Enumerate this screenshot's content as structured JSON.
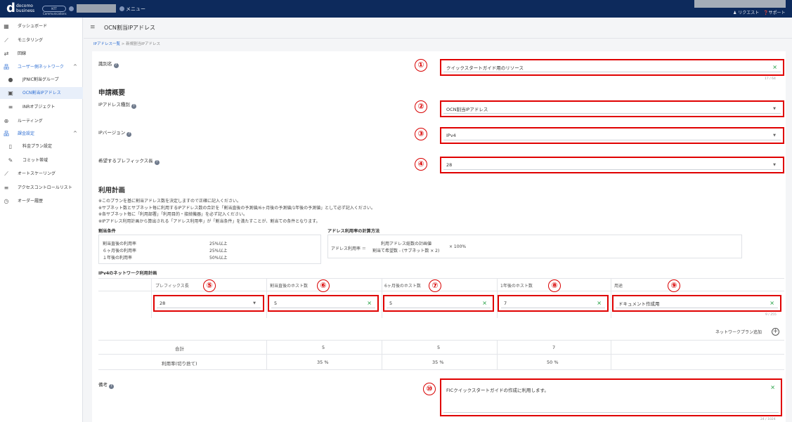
{
  "header": {
    "brand_d": "d",
    "brand_text_1": "docomo",
    "brand_text_2": "business",
    "partner_logo": "NTT Communications",
    "menu_label": "メニュー",
    "request_label": "リクエスト",
    "support_label": "サポート"
  },
  "sidebar": {
    "items": [
      {
        "label": "ダッシュボード",
        "icon": "dashboard-icon"
      },
      {
        "label": "モニタリング",
        "icon": "chart-icon"
      },
      {
        "label": "回線",
        "icon": "line-icon"
      },
      {
        "label": "ユーザー側ネットワーク",
        "icon": "network-icon"
      },
      {
        "label": "JPNIC割当グループ",
        "icon": "user-icon"
      },
      {
        "label": "OCN割当IPアドレス",
        "icon": "ip-icon"
      },
      {
        "label": "INRオブジェクト",
        "icon": "db-icon"
      },
      {
        "label": "ルーティング",
        "icon": "routing-icon"
      },
      {
        "label": "課金設定",
        "icon": "billing-icon"
      },
      {
        "label": "料金プラン設定",
        "icon": "doc-icon"
      },
      {
        "label": "コミット帯域",
        "icon": "edit-icon"
      },
      {
        "label": "オートスケーリング",
        "icon": "autoscale-icon"
      },
      {
        "label": "アクセスコントロールリスト",
        "icon": "acl-icon"
      },
      {
        "label": "オーダー履歴",
        "icon": "history-icon"
      }
    ]
  },
  "page": {
    "title": "OCN割当IPアドレス",
    "breadcrumb_link": "IPアドレス一覧",
    "breadcrumb_sep": ">",
    "breadcrumb_current": "新規割当IPアドレス"
  },
  "form": {
    "name_label": "識別名",
    "name_value": "クイックスタートガイド用のリソース",
    "name_counter": "17 / 64",
    "summary_heading": "申請概要",
    "ip_type_label": "IPアドレス種別",
    "ip_type_value": "OCN割当IPアドレス",
    "ip_version_label": "IPバージョン",
    "ip_version_value": "IPv4",
    "prefix_label": "希望するプレフィックス長",
    "prefix_value": "28",
    "plan_heading": "利用計画",
    "notes": [
      "※このプランを基に割当アドレス数を決定しますので正確に記入ください。",
      "※サブネット数とサブネット毎に利用するIPアドレス数の合計を「割当直後の予測値/6ヶ月後の予測値/1年後の予測値」として必ず記入ください。",
      "※各サブネット毎に「利用部署」「利用目的・接続機器」を必ず記入ください。",
      "※IPアドレス利用計画から算出される「アドレス利用率」が「割当条件」を満たすことが、割当ての条件となります。"
    ],
    "cond_title": "割当条件",
    "cond_rows": [
      {
        "label": "割当直後の利用率",
        "value": "25%以上"
      },
      {
        "label": "６ヶ月後の利用率",
        "value": "25%以上"
      },
      {
        "label": "１年後の利用率",
        "value": "50%以上"
      }
    ],
    "calc_title": "アドレス利用率の計算方法",
    "calc_lhs": "アドレス利用率 ＝",
    "calc_num": "利用アドレス総数の計画値",
    "calc_den": "割当て希望数 - (サブネット数 × 2)",
    "calc_mult": "× 100%",
    "network_plan_heading": "IPv4のネットワーク利用計画",
    "col_prefix": "プレフィックス長",
    "col_hosts_now": "割当直後のホスト数",
    "col_hosts_6m": "6ヶ月後のホスト数",
    "col_hosts_1y": "1年後のホスト数",
    "col_purpose": "用途",
    "row_prefix": "28",
    "row_hosts_now": "5",
    "row_hosts_6m": "5",
    "row_hosts_1y": "7",
    "row_purpose": "ドキュメント作成用",
    "purpose_counter": "9 / 255",
    "add_plan_label": "ネットワークプラン追加",
    "total_label": "合計",
    "total_now": "5",
    "total_6m": "5",
    "total_1y": "7",
    "rate_label": "利用率(切り捨て)",
    "rate_now": "35 %",
    "rate_6m": "35 %",
    "rate_1y": "50 %",
    "remarks_label": "備考",
    "remarks_value": "FICクイックスタートガイドの作成に利用します。",
    "remarks_counter": "24 / 1024"
  },
  "annotations": [
    "①",
    "②",
    "③",
    "④",
    "⑤",
    "⑥",
    "⑦",
    "⑧",
    "⑨",
    "⑩"
  ],
  "colors": {
    "accent": "#e00000",
    "topbar": "#0d2a5c",
    "link": "#2f6fd3",
    "clear": "#2ca34a"
  }
}
